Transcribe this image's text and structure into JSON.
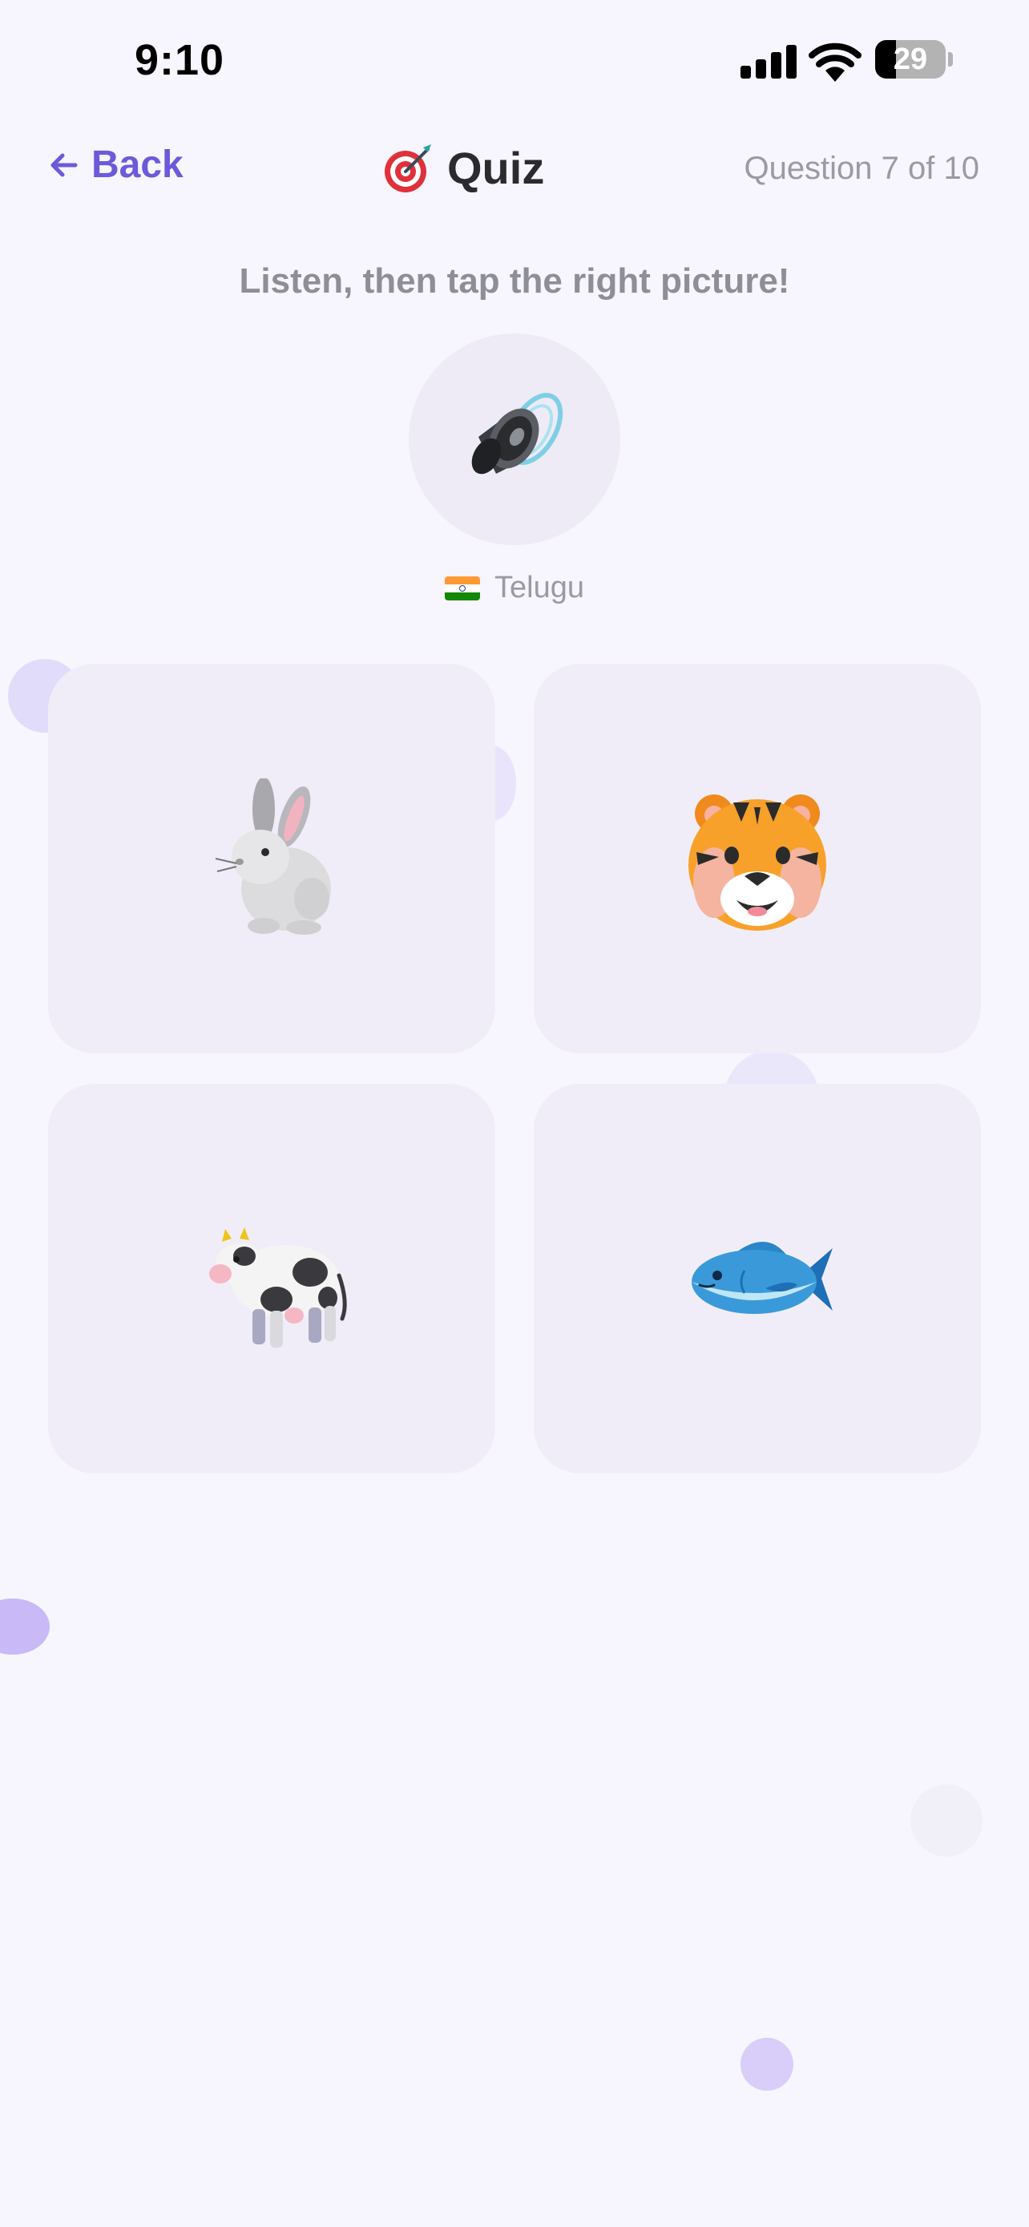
{
  "status_bar": {
    "time": "9:10",
    "battery_level": "29",
    "signal_icon": "cellular-signal-icon",
    "wifi_icon": "wifi-icon"
  },
  "header": {
    "back_label": "Back",
    "back_icon": "arrow-left-icon",
    "title": "Quiz",
    "title_icon": "target-icon",
    "progress": "Question 7 of 10"
  },
  "prompt": {
    "instruction": "Listen, then tap the right picture!",
    "audio_icon": "speaker-icon"
  },
  "language": {
    "flag_icon": "india-flag-icon",
    "name": "Telugu"
  },
  "choices": [
    {
      "icon": "rabbit-icon"
    },
    {
      "icon": "tiger-face-icon"
    },
    {
      "icon": "cow-icon"
    },
    {
      "icon": "fish-icon"
    }
  ],
  "colors": {
    "background": "#f7f5fd",
    "accent": "#6b5bd8",
    "card": "#f0edf8",
    "muted_text": "#9a9aa3"
  }
}
